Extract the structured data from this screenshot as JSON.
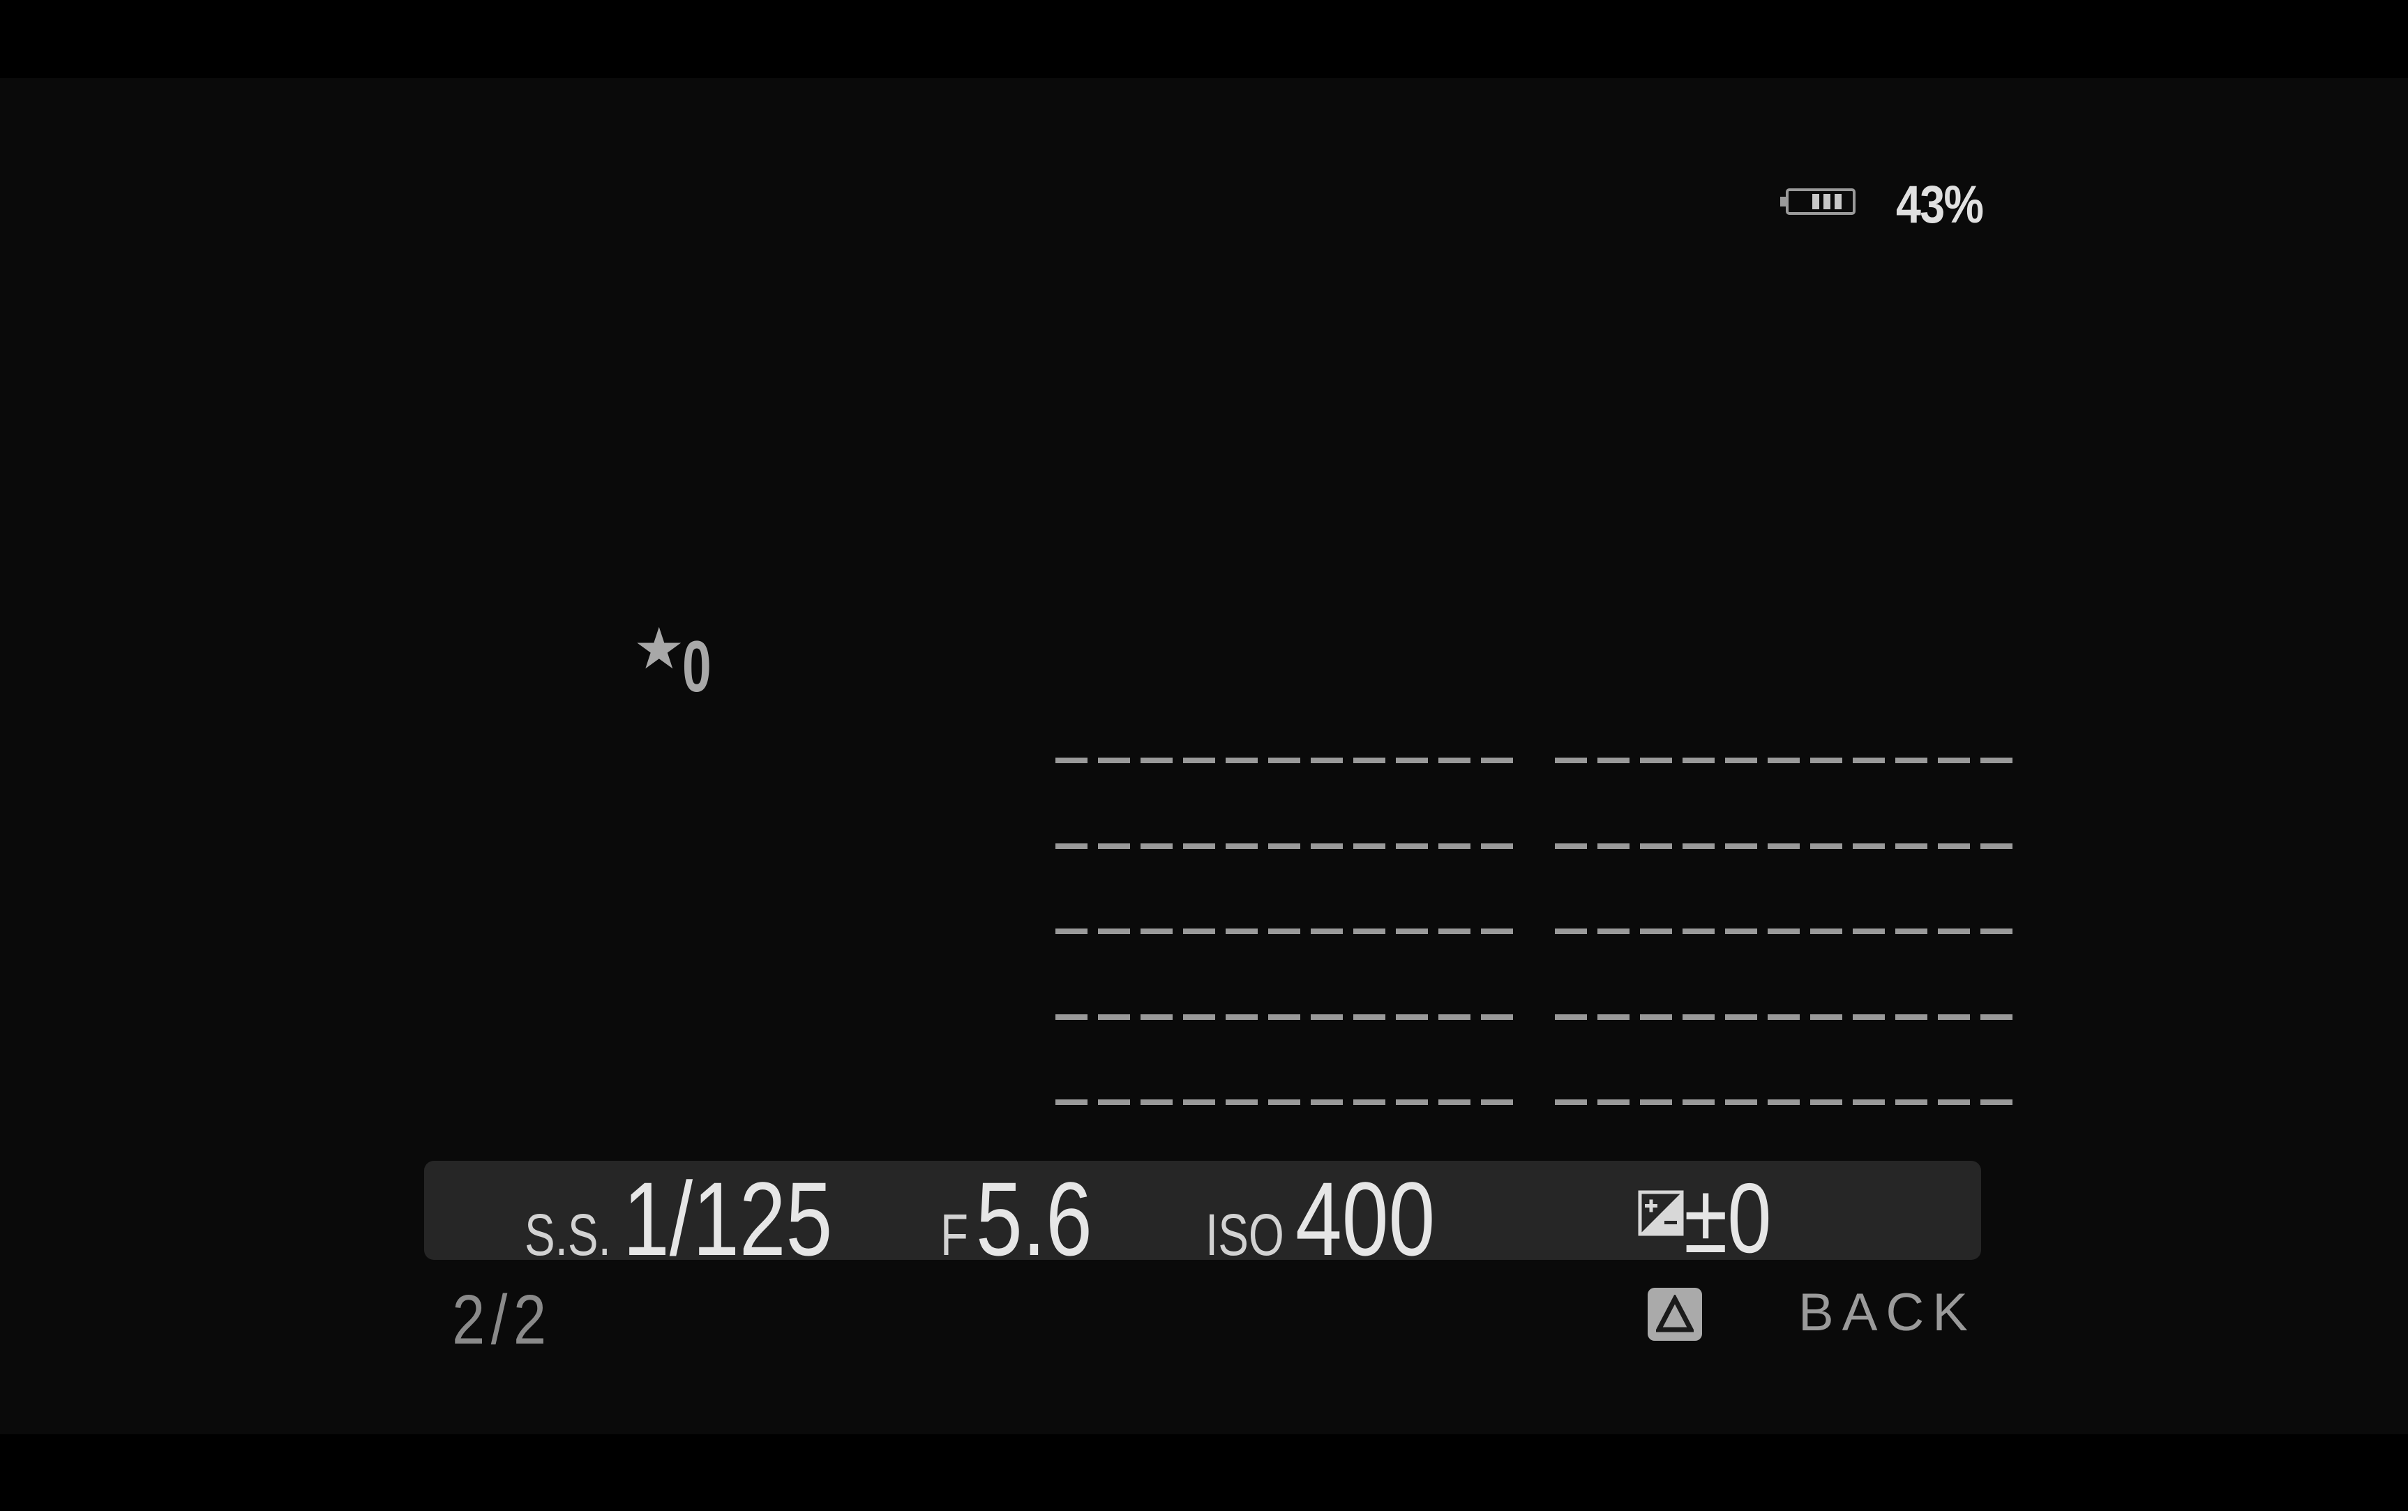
{
  "status": {
    "battery_icon": "battery-icon",
    "battery_level": "43%"
  },
  "rating": {
    "icon": "star-icon",
    "stars": "0"
  },
  "info_rows": {
    "placeholder": "------------",
    "rows": 5
  },
  "exposure": {
    "shutter_label": "S.S.",
    "shutter_value": "1/125",
    "aperture_label": "F",
    "aperture_value": "5.6",
    "iso_label": "ISO",
    "iso_value": "400",
    "ev_icon": "exposure-compensation-icon",
    "ev_value": "±0"
  },
  "footer": {
    "page": "2/2",
    "up_button_icon": "triangle-up-icon",
    "back_label": "BACK"
  },
  "colors": {
    "background": "#0a0a0a",
    "info_bar": "#262626",
    "text": "#e6e6e6",
    "muted_text": "#9a9a9a"
  }
}
